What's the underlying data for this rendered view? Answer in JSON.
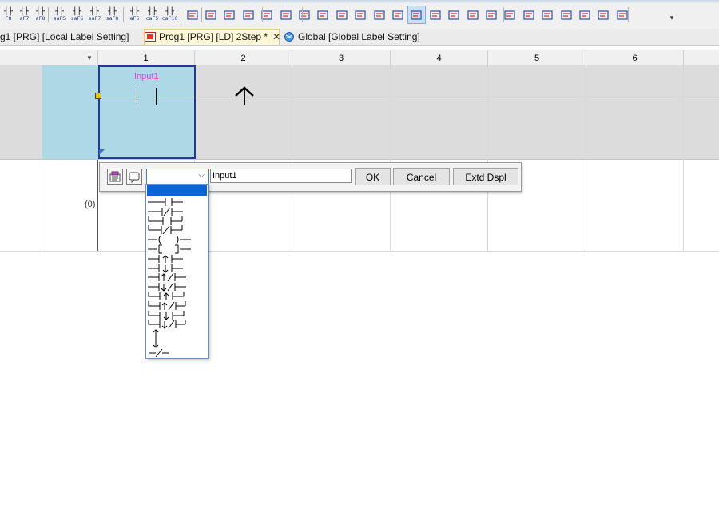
{
  "toolbar": {
    "row": [
      {
        "icon": "f8-contact-icon",
        "sub": "F8"
      },
      {
        "icon": "af7-contact-icon",
        "sub": "aF7"
      },
      {
        "icon": "af8-contact-icon",
        "sub": "aF8"
      },
      {
        "icon": "saf5-contact-icon",
        "sub": "saF5"
      },
      {
        "icon": "saf6-contact-icon",
        "sub": "saF6"
      },
      {
        "icon": "saf7-contact-icon",
        "sub": "saF7"
      },
      {
        "icon": "saf8-contact-icon",
        "sub": "saF8"
      },
      {
        "icon": "af5-icon",
        "sub": "aF5"
      },
      {
        "icon": "caf5-icon",
        "sub": "caF5"
      },
      {
        "icon": "caf10-icon",
        "sub": "caF10"
      }
    ]
  },
  "tabs": [
    {
      "label": "g1 [PRG] [Local Label Setting]"
    },
    {
      "label": "Prog1 [PRG] [LD] 2Step *"
    },
    {
      "label": "Global [Global Label Setting]"
    }
  ],
  "columns": [
    "1",
    "2",
    "3",
    "4",
    "5",
    "6"
  ],
  "ladder": {
    "contact_label": "Input1",
    "step_number": "(0)"
  },
  "dialog": {
    "name_value": "Input1",
    "ok_label": "OK",
    "cancel_label": "Cancel",
    "extend_label": "Extd Dspl"
  },
  "dropdown": {
    "items": [
      "normally-open-contact",
      "normally-closed-contact",
      "or-open-contact",
      "or-closed-contact",
      "coil",
      "application-instruction",
      "rising-pulse-contact",
      "falling-pulse-contact",
      "rising-pulse-closed-contact",
      "falling-pulse-closed-contact",
      "or-rising-pulse",
      "or-rising-pulse-closed",
      "or-falling-pulse",
      "or-falling-pulse-closed",
      "rising-edge",
      "falling-edge",
      "invert"
    ]
  }
}
